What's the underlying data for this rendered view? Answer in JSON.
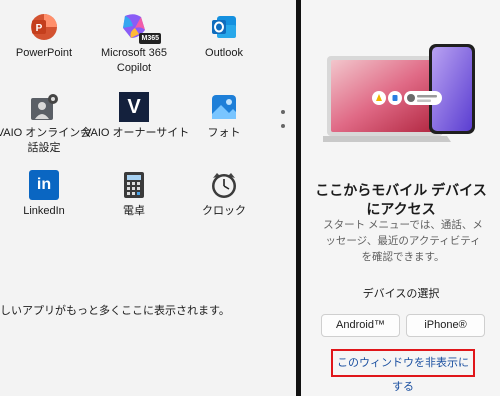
{
  "apps": [
    {
      "label": "PowerPoint",
      "icon": "powerpoint-icon"
    },
    {
      "label": "Microsoft 365\nCopilot",
      "icon": "copilot-icon",
      "badge": "M365"
    },
    {
      "label": "Outlook",
      "icon": "outlook-icon"
    },
    {
      "label": "VAIO オンライン会\n話設定",
      "icon": "vaio-settings-icon"
    },
    {
      "label": "VAIO オーナーサイト",
      "icon": "vaio-owner-icon",
      "glyph": "V"
    },
    {
      "label": "フォト",
      "icon": "photos-icon"
    },
    {
      "label": "LinkedIn",
      "icon": "linkedin-icon",
      "glyph": "in"
    },
    {
      "label": "電卓",
      "icon": "calculator-icon"
    },
    {
      "label": "クロック",
      "icon": "clock-icon"
    }
  ],
  "more_apps_text": "しいアプリがもっと多くここに表示されます。",
  "phone_link": {
    "title": "ここからモバイル デバイスにアクセス",
    "description": "スタート メニューでは、通話、メッセージ、最近のアクティビティを確認できます。",
    "select_label": "デバイスの選択",
    "android_label": "Android™",
    "iphone_label": "iPhone®",
    "hide_label": "このウィンドウを非表示にする"
  },
  "colors": {
    "highlight_border": "#e0161a",
    "link": "#1a4fa0"
  }
}
